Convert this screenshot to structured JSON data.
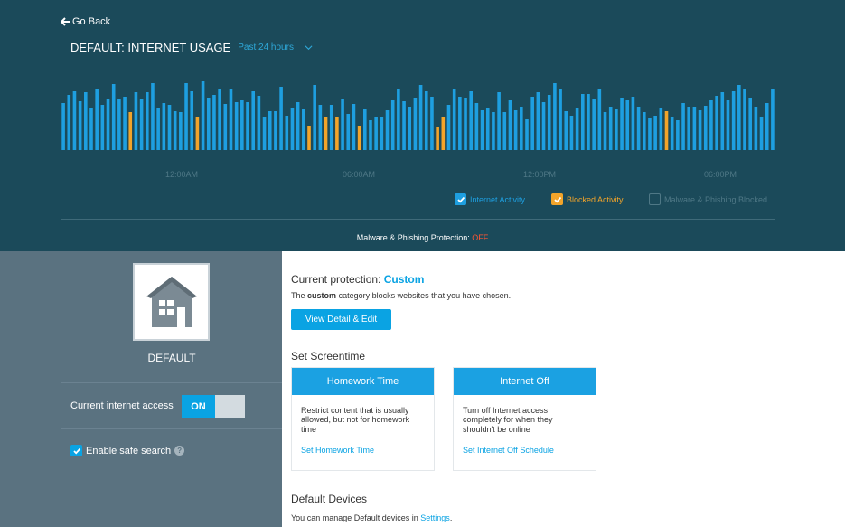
{
  "header": {
    "go_back": "Go Back",
    "title": "DEFAULT: INTERNET USAGE",
    "range": "Past 24 hours",
    "malware_protection": {
      "label": "Malware & Phishing Protection:",
      "state": "OFF"
    }
  },
  "chart_data": {
    "type": "bar",
    "x_ticks": [
      "12:00AM",
      "06:00AM",
      "12:00PM",
      "06:00PM"
    ],
    "legend": [
      {
        "label": "Internet Activity",
        "checked": true,
        "color": "#1e9fe0"
      },
      {
        "label": "Blocked Activity",
        "checked": true,
        "color": "#f2a42a"
      },
      {
        "label": "Malware & Phishing Blocked",
        "checked": false,
        "color": "#4f7886"
      }
    ],
    "series": [
      {
        "name": "Internet Activity",
        "values": [
          0.52,
          0.61,
          0.65,
          0.54,
          0.64,
          0.46,
          0.67,
          0.5,
          0.57,
          0.73,
          0.56,
          0.59,
          0.54,
          0.64,
          0.57,
          0.64,
          0.74,
          0.46,
          0.52,
          0.5,
          0.43,
          0.42,
          0.74,
          0.65,
          0.52,
          0.76,
          0.58,
          0.61,
          0.67,
          0.51,
          0.67,
          0.53,
          0.55,
          0.53,
          0.65,
          0.6,
          0.37,
          0.43,
          0.43,
          0.7,
          0.38,
          0.47,
          0.53,
          0.45,
          0.48,
          0.72,
          0.5,
          0.57,
          0.5,
          0.58,
          0.56,
          0.4,
          0.51,
          0.42,
          0.45,
          0.33,
          0.37,
          0.37,
          0.44,
          0.55,
          0.67,
          0.54,
          0.48,
          0.58,
          0.72,
          0.65,
          0.59,
          0.67,
          0.48,
          0.5,
          0.67,
          0.59,
          0.58,
          0.65,
          0.52,
          0.44,
          0.47,
          0.42,
          0.64,
          0.42,
          0.55,
          0.44,
          0.48,
          0.34,
          0.59,
          0.64,
          0.53,
          0.61,
          0.74,
          0.68,
          0.43,
          0.38,
          0.47,
          0.62,
          0.62,
          0.56,
          0.67,
          0.42,
          0.48,
          0.45,
          0.58,
          0.55,
          0.59,
          0.48,
          0.42,
          0.35,
          0.38,
          0.47,
          0.39,
          0.37,
          0.33,
          0.52,
          0.48,
          0.48,
          0.44,
          0.49,
          0.55,
          0.6,
          0.64,
          0.55,
          0.65,
          0.72,
          0.67,
          0.58,
          0.48,
          0.37,
          0.52,
          0.67
        ]
      },
      {
        "name": "Blocked Activity",
        "values": [
          0,
          0,
          0,
          0,
          0,
          0,
          0,
          0,
          0,
          0,
          0,
          0,
          0.42,
          0,
          0,
          0,
          0,
          0,
          0,
          0,
          0,
          0,
          0,
          0,
          0.37,
          0,
          0,
          0,
          0,
          0,
          0,
          0,
          0,
          0,
          0,
          0,
          0,
          0,
          0,
          0,
          0,
          0,
          0,
          0,
          0.27,
          0,
          0,
          0.37,
          0,
          0.37,
          0,
          0,
          0,
          0.27,
          0,
          0,
          0,
          0,
          0,
          0,
          0,
          0,
          0,
          0,
          0,
          0,
          0,
          0.26,
          0.37,
          0,
          0,
          0,
          0,
          0,
          0,
          0,
          0,
          0,
          0,
          0,
          0,
          0,
          0,
          0,
          0,
          0,
          0,
          0,
          0,
          0,
          0,
          0,
          0,
          0,
          0,
          0,
          0,
          0,
          0,
          0,
          0,
          0,
          0,
          0,
          0,
          0,
          0,
          0,
          0.43,
          0,
          0,
          0,
          0,
          0,
          0,
          0,
          0,
          0,
          0,
          0,
          0,
          0,
          0,
          0,
          0,
          0
        ]
      }
    ]
  },
  "sidebar": {
    "profile_name": "DEFAULT",
    "access_label": "Current internet access",
    "access_toggle": "ON",
    "safe_search_label": "Enable safe search",
    "safe_search_checked": true
  },
  "main": {
    "protection": {
      "label": "Current protection:",
      "value": "Custom",
      "desc_prefix": "The",
      "desc_bold": "custom",
      "desc_suffix": "category blocks websites that you have chosen.",
      "button": "View Detail & Edit"
    },
    "screentime": {
      "title": "Set Screentime",
      "cards": [
        {
          "title": "Homework Time",
          "body": "Restrict content that is usually allowed, but not for homework time",
          "link": "Set Homework Time"
        },
        {
          "title": "Internet Off",
          "body": "Turn off Internet access completely for when they shouldn't be online",
          "link": "Set Internet Off Schedule"
        }
      ]
    },
    "devices": {
      "title": "Default Devices",
      "desc": "You can manage Default devices in",
      "link": "Settings",
      "end": "."
    }
  }
}
